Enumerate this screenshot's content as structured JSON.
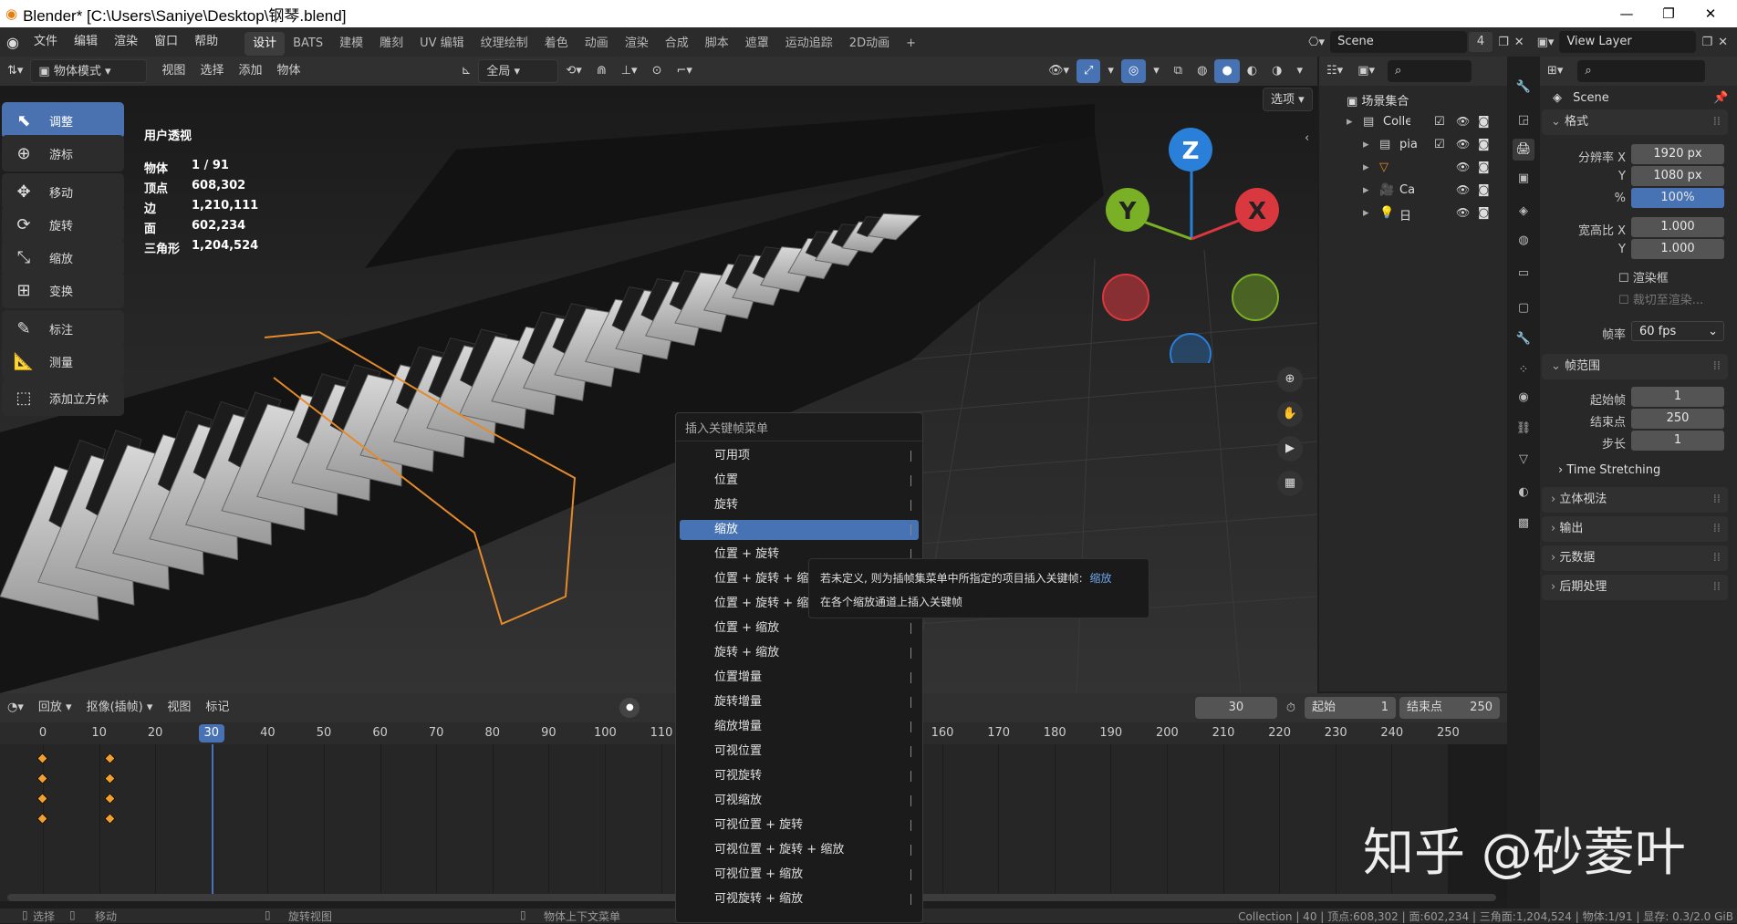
{
  "window": {
    "title": "Blender* [C:\\Users\\Saniye\\Desktop\\钢琴.blend]",
    "minimize": "—",
    "maximize": "❐",
    "close": "✕"
  },
  "menu": [
    "文件",
    "编辑",
    "渲染",
    "窗口",
    "帮助"
  ],
  "workspaces": [
    "设计",
    "BATS",
    "建模",
    "雕刻",
    "UV 编辑",
    "纹理绘制",
    "着色",
    "动画",
    "渲染",
    "合成",
    "脚本",
    "遮罩",
    "运动追踪",
    "2D动画",
    "+"
  ],
  "scene": {
    "name": "Scene",
    "count": "4",
    "view_layer": "View Layer"
  },
  "viewport_header": {
    "mode": "物体模式",
    "view": "视图",
    "select": "选择",
    "add": "添加",
    "object": "物体",
    "transform_orient": "全局",
    "options": "选项"
  },
  "tools": [
    "调整",
    "游标",
    "移动",
    "旋转",
    "缩放",
    "变换",
    "标注",
    "测量",
    "添加立方体"
  ],
  "stats": {
    "view_name": "用户透视",
    "rows": [
      {
        "label": "物体",
        "value": "1 / 91"
      },
      {
        "label": "顶点",
        "value": "608,302"
      },
      {
        "label": "边",
        "value": "1,210,111"
      },
      {
        "label": "面",
        "value": "602,234"
      },
      {
        "label": "三角形",
        "value": "1,204,524"
      }
    ]
  },
  "gizmo": {
    "z": "Z",
    "y": "Y",
    "x": "X"
  },
  "outliner": {
    "root": "场景集合",
    "items": [
      "Collect",
      "pia",
      "",
      "Ca",
      "日"
    ]
  },
  "properties": {
    "scene_name": "Scene",
    "format_title": "格式",
    "res_x_label": "分辨率 X",
    "res_x": "1920 px",
    "res_y_label": "Y",
    "res_y": "1080 px",
    "pct_label": "%",
    "pct": "100%",
    "aspect_x_label": "宽高比 X",
    "aspect_x": "1.000",
    "aspect_y_label": "Y",
    "aspect_y": "1.000",
    "render_region": "渲染框",
    "crop": "裁切至渲染...",
    "fps_label": "帧率",
    "fps": "60 fps",
    "frame_range_title": "帧范围",
    "start_label": "起始帧",
    "start": "1",
    "end_label": "结束点",
    "end": "250",
    "step_label": "步长",
    "step": "1",
    "time_stretching": "Time Stretching",
    "stereo": "立体视法",
    "output": "输出",
    "metadata": "元数据",
    "post": "后期处理"
  },
  "timeline": {
    "playback": "回放",
    "keying": "抠像(插帧)",
    "view": "视图",
    "marker": "标记",
    "current_frame": "30",
    "start_label": "起始",
    "start": "1",
    "end_label": "结束点",
    "end": "250",
    "ruler": [
      "0",
      "10",
      "20",
      "30",
      "40",
      "50",
      "60",
      "70",
      "80",
      "90",
      "100",
      "110",
      "160",
      "170",
      "180",
      "190",
      "200",
      "210",
      "220",
      "230",
      "240",
      "250"
    ]
  },
  "popup": {
    "title": "插入关键帧菜单",
    "items": [
      "可用项",
      "位置",
      "旋转",
      "缩放",
      "位置 + 旋转",
      "位置 + 旋转 + 缩",
      "位置 + 旋转 + 缩",
      "位置 + 缩放",
      "旋转 + 缩放",
      "位置增量",
      "旋转增量",
      "缩放增量",
      "可视位置",
      "可视旋转",
      "可视缩放",
      "可视位置 + 旋转",
      "可视位置 + 旋转 + 缩放",
      "可视位置 + 缩放",
      "可视旋转 + 缩放"
    ],
    "selected_index": 3
  },
  "tooltip": {
    "line1": "若未定义, 则为插帧集菜单中所指定的项目插入关键帧:",
    "line1_accent": "缩放",
    "line2": "在各个缩放通道上插入关键帧"
  },
  "statusbar": {
    "select": "选择",
    "move": "移动",
    "rotate_view": "旋转视图",
    "context_menu": "物体上下文菜单",
    "info": "Collection | 40 | 顶点:608,302 | 面:602,234 | 三角面:1,204,524 | 物体:1/91 | 显存: 0.3/2.0 GiB"
  },
  "watermark": "知乎 @砂菱叶",
  "colors": {
    "accent": "#4772b3",
    "selection_outline": "#e58a2b",
    "keyframe": "#f0a030",
    "x_axis": "#d9383e",
    "y_axis": "#7ab026",
    "z_axis": "#2a7fd8"
  }
}
